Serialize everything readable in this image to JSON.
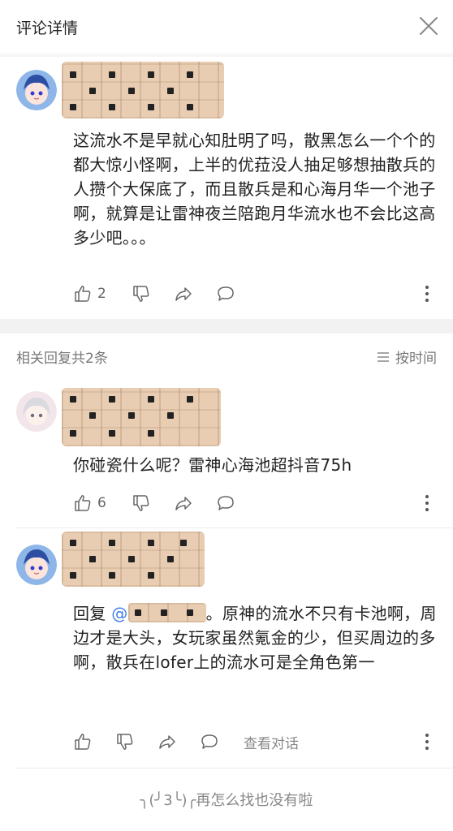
{
  "header": {
    "title": "评论详情",
    "close_icon": "close-icon"
  },
  "main_comment": {
    "text": "这流水不是早就心知肚明了吗，散黑怎么一个个的都大惊小怪啊，上半的优菈没人抽足够想抽散兵的人攒个大保底了，而且散兵是和心海月华一个池子啊，就算是让雷神夜兰陪跑月华流水也不会比这高多少吧。。。",
    "likes": "2"
  },
  "replies_header": {
    "count_label": "相关回复共2条",
    "sort_label": "按时间"
  },
  "replies": [
    {
      "text": "你碰瓷什么呢？雷神心海池超抖音75h",
      "likes": "6"
    },
    {
      "reply_prefix": "回复 ",
      "mention_symbol": "@",
      "text": "。原神的流水不只有卡池啊，周边才是大头，女玩家虽然氪金的少，但买周边的多啊，散兵在lofer上的流水可是全角色第一",
      "view_conversation_label": "查看对话"
    }
  ],
  "footer": {
    "end_text": "╮(╯3╰)╭再怎么找也没有啦"
  },
  "colors": {
    "accent": "#3d7ee8",
    "divider": "#f2f2f2",
    "icon_gray": "#666666"
  }
}
